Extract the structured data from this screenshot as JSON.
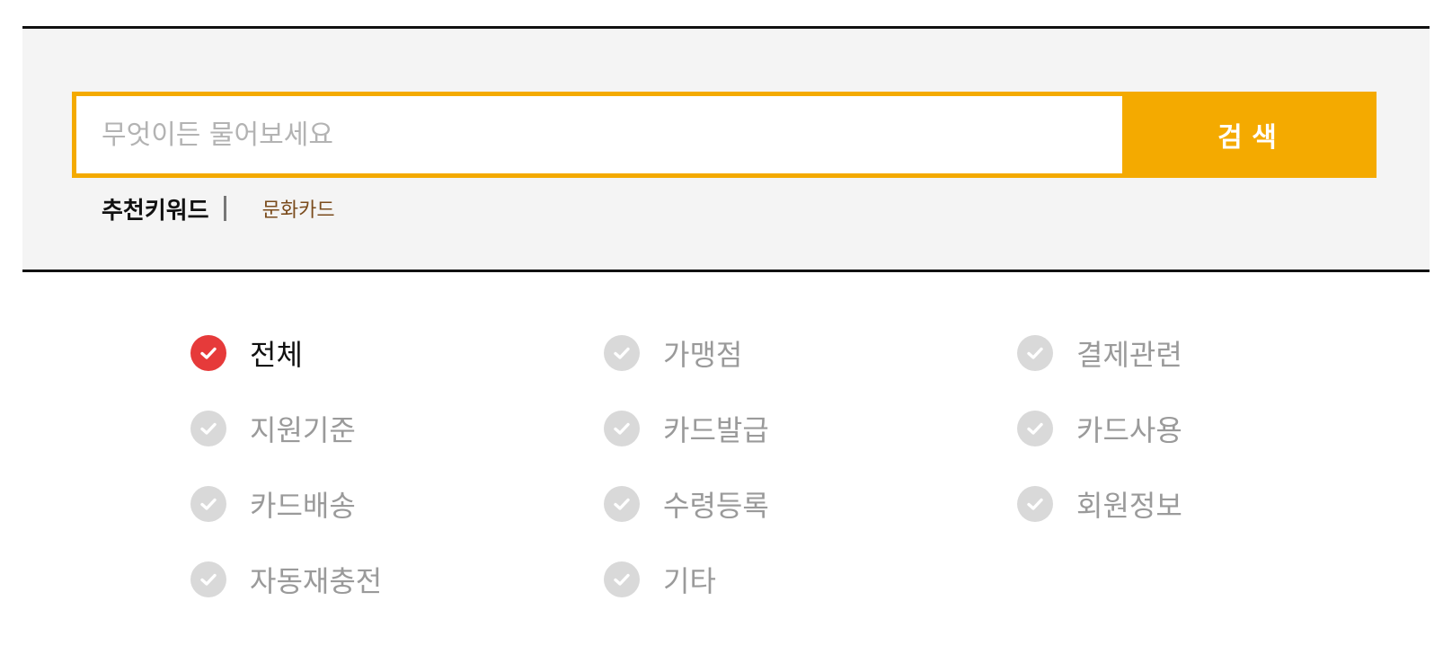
{
  "search": {
    "placeholder": "무엇이든 물어보세요",
    "value": "",
    "button_label": "검 색"
  },
  "recommended": {
    "title": "추천키워드",
    "keywords": [
      "문화카드"
    ]
  },
  "categories": [
    {
      "label": "전체",
      "selected": true
    },
    {
      "label": "가맹점",
      "selected": false
    },
    {
      "label": "결제관련",
      "selected": false
    },
    {
      "label": "지원기준",
      "selected": false
    },
    {
      "label": "카드발급",
      "selected": false
    },
    {
      "label": "카드사용",
      "selected": false
    },
    {
      "label": "카드배송",
      "selected": false
    },
    {
      "label": "수령등록",
      "selected": false
    },
    {
      "label": "회원정보",
      "selected": false
    },
    {
      "label": "자동재충전",
      "selected": false
    },
    {
      "label": "기타",
      "selected": false
    }
  ],
  "colors": {
    "accent": "#f4aa00",
    "selected_check": "#e63a3a",
    "unselected_check": "#d9d9d9",
    "keyword_link": "#7a4b1c"
  },
  "icons": {
    "check": "check-circle-icon"
  }
}
